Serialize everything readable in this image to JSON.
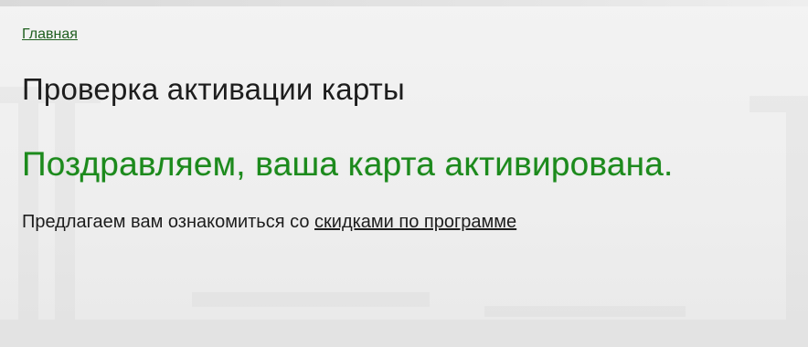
{
  "breadcrumb": {
    "home_label": "Главная"
  },
  "page": {
    "title": "Проверка активации карты",
    "success_message": "Поздравляем, ваша карта активирована.",
    "promo_text": "Предлагаем вам ознакомиться со ",
    "promo_link_label": "скидками по программе"
  },
  "colors": {
    "success_green": "#1c8a1c",
    "link_green": "#1f5f1f",
    "text": "#1d1d1d",
    "background": "#ececec"
  }
}
